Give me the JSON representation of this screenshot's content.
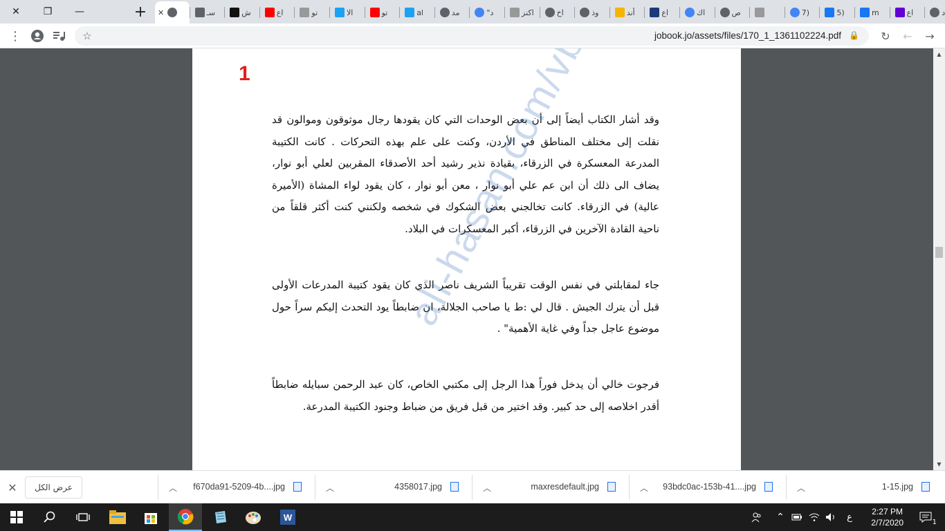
{
  "browser": {
    "window_controls": {
      "close": "✕",
      "maximize": "❐",
      "minimize": "—"
    },
    "new_tab": "+",
    "tabs": [
      {
        "label": "",
        "favicon": "globe",
        "color": "#5f6368"
      },
      {
        "label": "سـ",
        "favicon": "doc",
        "color": "#5f6368"
      },
      {
        "label": "ش",
        "favicon": "dark-square",
        "color": "#111111"
      },
      {
        "label": "اع",
        "favicon": "youtube",
        "color": "#ff0000"
      },
      {
        "label": "تو",
        "favicon": "image",
        "color": "#999999"
      },
      {
        "label": "الا",
        "favicon": "twitter",
        "color": "#1da1f2"
      },
      {
        "label": "تو",
        "favicon": "youtube",
        "color": "#ff0000"
      },
      {
        "label": "al",
        "favicon": "twitter",
        "color": "#1da1f2"
      },
      {
        "label": "مد",
        "favicon": "globe",
        "color": "#5f6368"
      },
      {
        "label": "\"د",
        "favicon": "google",
        "color": "#4285f4"
      },
      {
        "label": "اكنز",
        "favicon": "doc",
        "color": "#999999"
      },
      {
        "label": "اخ",
        "favicon": "globe",
        "color": "#5f6368"
      },
      {
        "label": "وذ",
        "favicon": "globe",
        "color": "#5f6368"
      },
      {
        "label": "أند",
        "favicon": "star",
        "color": "#f4b400"
      },
      {
        "label": "اع",
        "favicon": "skynews",
        "color": "#1a3a7a"
      },
      {
        "label": "اك",
        "favicon": "google",
        "color": "#4285f4"
      },
      {
        "label": "ص",
        "favicon": "globe",
        "color": "#5f6368"
      },
      {
        "label": "",
        "favicon": "doc",
        "color": "#999999"
      },
      {
        "label": "7)",
        "favicon": "google",
        "color": "#4285f4"
      },
      {
        "label": "5)",
        "favicon": "facebook",
        "color": "#1877f2"
      },
      {
        "label": "m",
        "favicon": "facebook",
        "color": "#1877f2"
      },
      {
        "label": "اع",
        "favicon": "yahoo-mail",
        "color": "#6001d2"
      },
      {
        "label": "أد",
        "favicon": "globe",
        "color": "#5f6368"
      }
    ],
    "url": "jobook.jo/assets/files/170_1_1361102224.pdf",
    "toolbar_icons": [
      "menu-icon",
      "profile-icon",
      "media-icon",
      "bookmark-star-icon",
      "lock-icon",
      "reload-icon",
      "back-icon",
      "forward-icon"
    ]
  },
  "document": {
    "page_number": "1",
    "paragraphs": [
      "وقد أشار الكتاب أيضاً إلى أن بعض الوحدات التي كان يقودها رجال موثوقون وموالون قد نقلت إلى مختلف المناطق في الأردن، وكنت على علم بهذه التحركات . كانت الكتيبة المدرعة المعسكرة في الزرقاء، بقيادة نذير رشيد أحد الأصدقاء المقربين لعلي أبو نوار، يضاف الى ذلك أن ابن عم علي أبو نوار ، معن أبو نوار ، كان يقود لواء المشاة (الأميرة عالية) في الزرقاء. كانت تخالجني بعض الشكوك في شخصه ولكنني كنت أكثر قلقاً من ناحية القادة الآخرين في الزرقاء، أكبر المعسكرات في البلاد.",
      "جاء لمقابلتي في نفس الوقت تقريباً الشريف ناصر الذي كان يقود كتيبة المدرعات الأولى قبل أن يترك الجيش . قال لي :ط يا صاحب الجلالة، ان ضابطاً يود التحدث إليكم سراً حول موضوع عاجل جداً وفي غاية الأهمية\" .",
      "فرجوت خالي أن يدخل فوراً هذا الرجل إلى مكتبي الخاص، كان عبد الرحمن سبايله ضابطاً أقدر اخلاصه إلى حد كبير. وقد اختير من قبل فريق من ضباط وجنود الكتيبة المدرعة."
    ],
    "watermark": "ali-hasan.com/vb"
  },
  "downloads": {
    "show_all_label": "عرض الكل",
    "items": [
      {
        "name": "f670da91-5209-4b....jpg"
      },
      {
        "name": "4358017.jpg"
      },
      {
        "name": "maxresdefault.jpg"
      },
      {
        "name": "93bdc0ac-153b-41....jpg"
      },
      {
        "name": "1-15.jpg"
      }
    ]
  },
  "taskbar": {
    "apps": [
      "windows-start-icon",
      "search-icon",
      "task-view-icon",
      "file-explorer-icon",
      "store-icon",
      "chrome-icon",
      "notepad-icon",
      "paint-icon",
      "word-icon"
    ],
    "tray": {
      "language": "ع",
      "time": "2:27 PM",
      "date": "2/7/2020",
      "notification_count": "1"
    }
  }
}
